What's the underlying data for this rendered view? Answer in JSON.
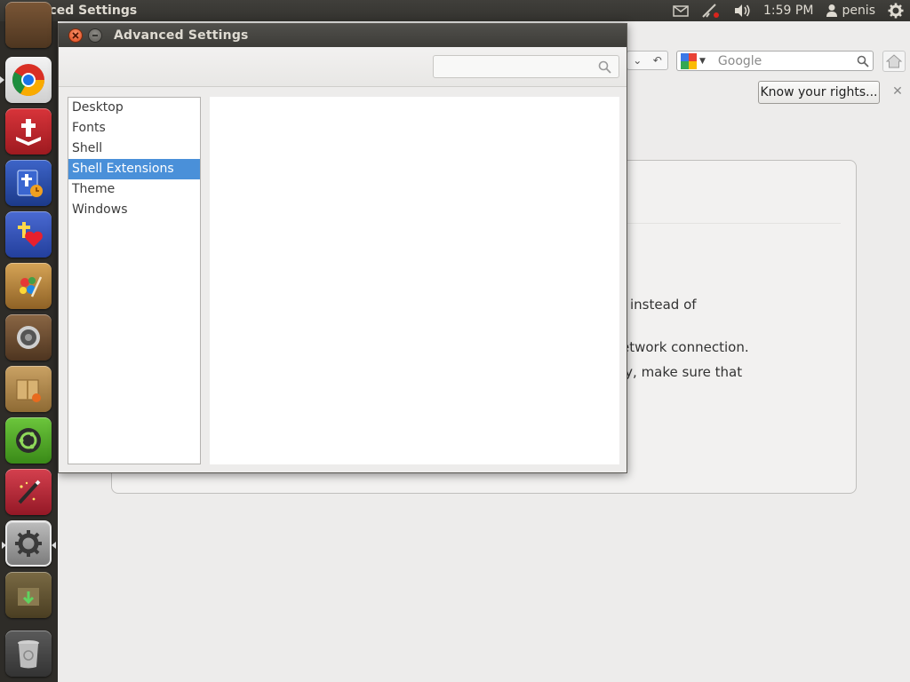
{
  "top_panel": {
    "app_title": "Advanced Settings",
    "clock": "1:59 PM",
    "username": "penis",
    "icons": [
      "mail-icon",
      "network-offline-icon",
      "volume-icon",
      "user-icon",
      "gear-icon"
    ]
  },
  "launcher": {
    "items": [
      {
        "name": "launcher-item-partial",
        "color": "#6a4a2a"
      },
      {
        "name": "launcher-item-chromium",
        "color": "#e0e0e0",
        "running": true
      },
      {
        "name": "launcher-item-bible-red",
        "color": "#c0262e"
      },
      {
        "name": "launcher-item-bible-blue",
        "color": "#2a4ea8"
      },
      {
        "name": "launcher-item-bible-heart",
        "color": "#3555b8"
      },
      {
        "name": "launcher-item-art-palette",
        "color": "#b07a2e"
      },
      {
        "name": "launcher-item-speaker",
        "color": "#6b4a2c"
      },
      {
        "name": "launcher-item-package",
        "color": "#a07a3e"
      },
      {
        "name": "launcher-item-ubuntu-software",
        "color": "#4caa2a"
      },
      {
        "name": "launcher-item-magic-wand",
        "color": "#b8283a"
      },
      {
        "name": "launcher-item-system-settings",
        "color": "#9a9a9a",
        "running": true,
        "active": true
      },
      {
        "name": "launcher-item-download",
        "color": "#5a4a2a"
      },
      {
        "name": "launcher-item-trash",
        "color": "#4a4a4a"
      }
    ]
  },
  "browser_bg": {
    "search_placeholder": "Google",
    "rights_button": "Know your rights...",
    "close_symbol": "✕",
    "text_lines": [
      "instead of",
      "etwork connection.",
      "ky, make sure that"
    ]
  },
  "dialog": {
    "title": "Advanced Settings",
    "search_value": "",
    "sidebar": [
      "Desktop",
      "Fonts",
      "Shell",
      "Shell Extensions",
      "Theme",
      "Windows"
    ],
    "selected_index": 3
  },
  "colors": {
    "selection": "#4a90d9",
    "panel": "#3c3b37",
    "launcher": "#2e2c28",
    "close_button": "#e85d2a"
  }
}
